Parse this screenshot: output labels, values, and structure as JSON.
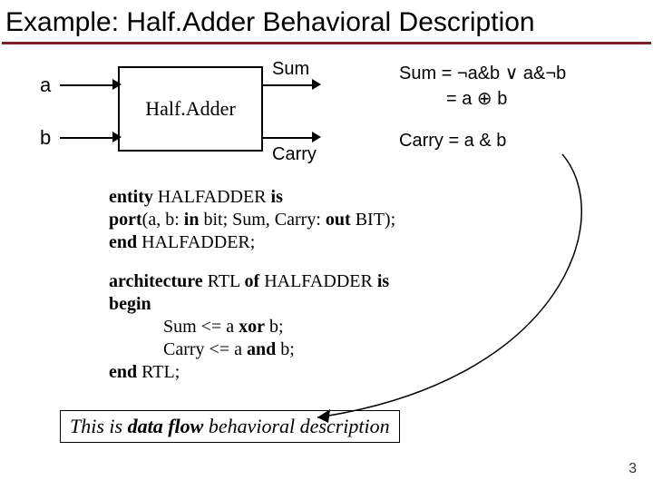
{
  "title": "Example: Half.Adder Behavioral Description",
  "diagram": {
    "input_a": "a",
    "input_b": "b",
    "block": "Half.Adder",
    "out_sum": "Sum",
    "out_carry": "Carry"
  },
  "equations": {
    "sum_line1": "Sum = ¬a&b ∨ a&¬b",
    "sum_line2": "= a ⊕ b",
    "carry": "Carry = a & b"
  },
  "code": {
    "l1a": "entity",
    "l1b": " HALFADDER ",
    "l1c": "is",
    "l2a": "port",
    "l2b": "(a, b: ",
    "l2c": "in",
    "l2d": " bit; Sum, Carry: ",
    "l2e": "out",
    "l2f": " BIT);",
    "l3a": "end",
    "l3b": " HALFADDER;",
    "l4a": "architecture",
    "l4b": " RTL ",
    "l4c": "of",
    "l4d": " HALFADDER ",
    "l4e": "is",
    "l5": "begin",
    "l6a": "Sum <= a ",
    "l6b": "xor",
    "l6c": " b;",
    "l7a": "Carry <= a ",
    "l7b": "and",
    "l7c": " b;",
    "l8a": "end",
    "l8b": " RTL;"
  },
  "callout": {
    "pre": "This is ",
    "mid": "data flow",
    "post": " behavioral description"
  },
  "page": "3"
}
